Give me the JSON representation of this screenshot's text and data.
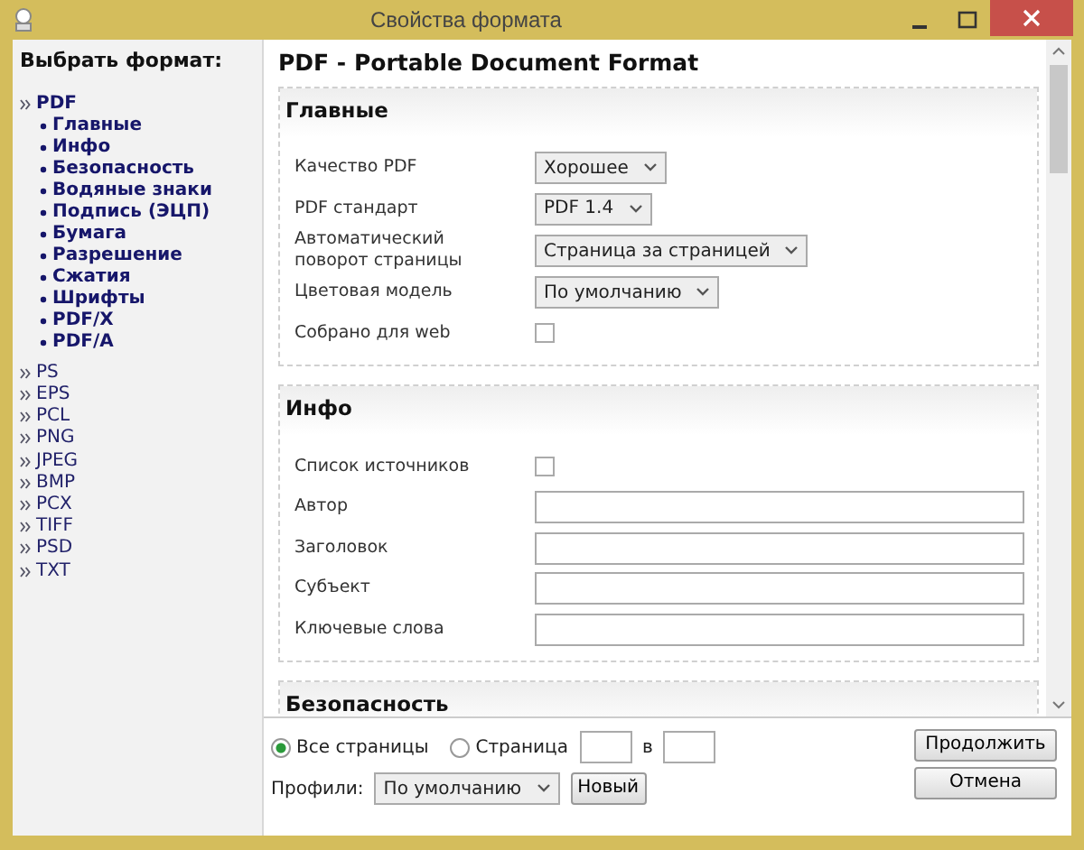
{
  "window": {
    "title": "Свойства формата"
  },
  "sidebar": {
    "heading": "Выбрать формат:",
    "formats": [
      {
        "label": "PDF",
        "selected": true,
        "children": [
          {
            "label": "Главные"
          },
          {
            "label": "Инфо"
          },
          {
            "label": "Безопасность"
          },
          {
            "label": "Водяные знаки"
          },
          {
            "label": "Подпись (ЭЦП)"
          },
          {
            "label": "Бумага"
          },
          {
            "label": "Разрешение"
          },
          {
            "label": "Сжатия"
          },
          {
            "label": "Шрифты"
          },
          {
            "label": "PDF/X"
          },
          {
            "label": "PDF/A"
          }
        ]
      },
      {
        "label": "PS",
        "selected": false
      },
      {
        "label": "EPS",
        "selected": false
      },
      {
        "label": "PCL",
        "selected": false
      },
      {
        "label": "PNG",
        "selected": false
      },
      {
        "label": "JPEG",
        "selected": false
      },
      {
        "label": "BMP",
        "selected": false
      },
      {
        "label": "PCX",
        "selected": false
      },
      {
        "label": "TIFF",
        "selected": false
      },
      {
        "label": "PSD",
        "selected": false
      },
      {
        "label": "TXT",
        "selected": false
      }
    ]
  },
  "main": {
    "title": "PDF - Portable Document Format",
    "sections": [
      {
        "heading": "Главные",
        "fields": [
          {
            "kind": "select",
            "label": "Качество PDF",
            "value": "Хорошее"
          },
          {
            "kind": "select",
            "label": "PDF стандарт",
            "value": "PDF 1.4"
          },
          {
            "kind": "select",
            "label": "Автоматический поворот страницы",
            "value": "Страница за страницей"
          },
          {
            "kind": "select",
            "label": "Цветовая модель",
            "value": "По умолчанию"
          },
          {
            "kind": "checkbox",
            "label": "Собрано для web",
            "checked": false
          }
        ]
      },
      {
        "heading": "Инфо",
        "fields": [
          {
            "kind": "checkbox",
            "label": "Список источников",
            "checked": false
          },
          {
            "kind": "text",
            "label": "Автор"
          },
          {
            "kind": "text",
            "label": "Заголовок"
          },
          {
            "kind": "text",
            "label": "Субъект"
          },
          {
            "kind": "text",
            "label": "Ключевые слова"
          }
        ]
      },
      {
        "heading": "Безопасность"
      }
    ]
  },
  "page_range": {
    "options": [
      {
        "label": "Все страницы",
        "selected": true
      },
      {
        "label": "Страница",
        "selected": false
      }
    ],
    "to_label": "в"
  },
  "profiles": {
    "label": "Профили:",
    "value": "По умолчанию",
    "new_button": "Новый"
  },
  "buttons": [
    "Продолжить",
    "Отмена"
  ]
}
